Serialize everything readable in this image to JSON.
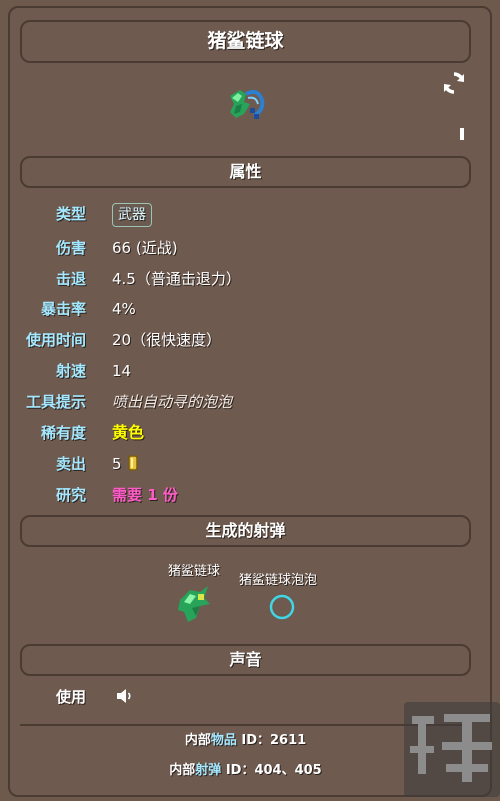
{
  "item": {
    "title": "猪鲨链球"
  },
  "sections": {
    "attributes": "属性",
    "projectiles": "生成的射弹",
    "sounds": "声音"
  },
  "attributes": {
    "type_label": "类型",
    "type_value": "武器",
    "damage_label": "伤害",
    "damage_value": "66 (近战)",
    "knockback_label": "击退",
    "knockback_value": "4.5（普通击退力）",
    "crit_label": "暴击率",
    "crit_value": "4%",
    "usetime_label": "使用时间",
    "usetime_value": "20（很快速度）",
    "velocity_label": "射速",
    "velocity_value": "14",
    "tooltip_label": "工具提示",
    "tooltip_value": "喷出自动寻的泡泡",
    "rarity_label": "稀有度",
    "rarity_value": "黄色",
    "sell_label": "卖出",
    "sell_value": "5",
    "research_label": "研究",
    "research_value": "需要 1 份"
  },
  "projectiles": [
    {
      "name": "猪鲨链球"
    },
    {
      "name": "猪鲨链球泡泡"
    }
  ],
  "sounds": {
    "use_label": "使用"
  },
  "footer": {
    "internal_item_prefix": "内部",
    "internal_item_hl": "物品",
    "internal_item_suffix": " ID：2611",
    "internal_proj_prefix": "内部",
    "internal_proj_hl": "射弹",
    "internal_proj_suffix": " ID：404、405"
  },
  "icons": {
    "refresh": "refresh-icon",
    "speaker": "speaker-icon",
    "coin": "gold-coin-icon"
  },
  "colors": {
    "label": "#a5e8ff",
    "rarity_yellow": "#ffff00",
    "research_pink": "#ff5cc8",
    "background": "#6e5a4e"
  }
}
